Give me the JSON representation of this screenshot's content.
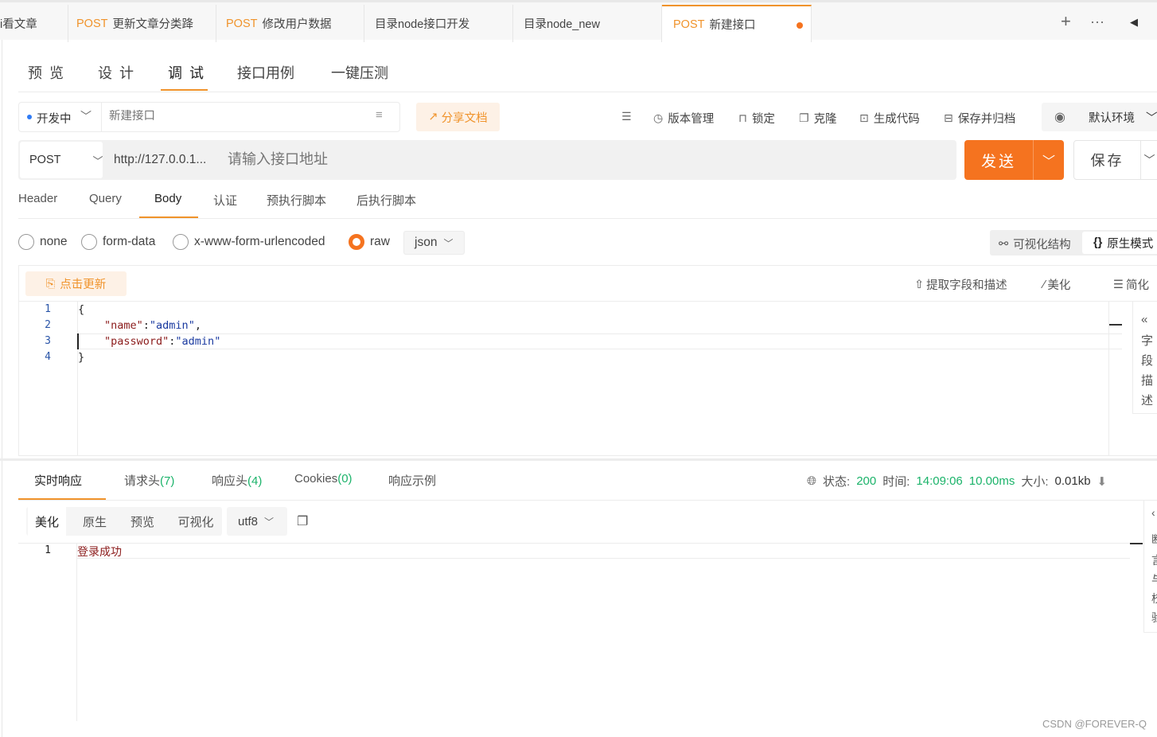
{
  "tabs": [
    {
      "method": "",
      "title": "i看文章"
    },
    {
      "method": "POST",
      "title": "更新文章分类跭"
    },
    {
      "method": "POST",
      "title": "修改用户数据"
    },
    {
      "method": "",
      "title": "目录node接口开发"
    },
    {
      "method": "",
      "title": "目录node_new"
    },
    {
      "method": "POST",
      "title": "新建接口"
    }
  ],
  "tabbar_icons": {
    "add": "+",
    "more": "···",
    "prev": "◀"
  },
  "subnav": [
    "预 览",
    "设 计",
    "调 试",
    "接口用例",
    "一键压测"
  ],
  "status": {
    "label": "开发中",
    "name_placeholder": "新建接口"
  },
  "share_button": "分享文档",
  "tools": [
    "版本管理",
    "锁定",
    "克隆",
    "生成代码",
    "保存并归档"
  ],
  "environment": "默认环境",
  "request": {
    "method": "POST",
    "url": "http://127.0.0.1...",
    "url_placeholder": "请输入接口地址",
    "send": "发送",
    "save": "保存"
  },
  "request_tabs": [
    "Header",
    "Query",
    "Body",
    "认证",
    "预执行脚本",
    "后执行脚本"
  ],
  "body_types": [
    "none",
    "form-data",
    "x-www-form-urlencoded",
    "raw"
  ],
  "body_format": "json",
  "modes": {
    "visual": "可视化结构",
    "raw": "原生模式"
  },
  "editor_toolbar": {
    "refresh": "点击更新",
    "extract": "提取字段和描述",
    "beautify": "美化",
    "simplify": "简化"
  },
  "code_lines": [
    {
      "no": "1",
      "key": "",
      "value": "{",
      "suffix": ""
    },
    {
      "no": "2",
      "key": "\"name\"",
      "value": "\"admin\"",
      "suffix": ","
    },
    {
      "no": "3",
      "key": "\"password\"",
      "value": "\"admin\"",
      "suffix": ""
    },
    {
      "no": "4",
      "key": "",
      "value": "}",
      "suffix": ""
    }
  ],
  "field_panel": [
    "«",
    "字",
    "段",
    "描",
    "述"
  ],
  "response_tabs": [
    {
      "label": "实时响应",
      "count": ""
    },
    {
      "label": "请求头",
      "count": "(7)"
    },
    {
      "label": "响应头",
      "count": "(4)"
    },
    {
      "label": "Cookies",
      "count": "(0)"
    },
    {
      "label": "响应示例",
      "count": ""
    }
  ],
  "response_meta": {
    "status_label": "状态:",
    "status": "200",
    "time_label": "时间:",
    "time": "14:09:06",
    "duration": "10.00ms",
    "size_label": "大小:",
    "size": "0.01kb"
  },
  "view_buttons": [
    "美化",
    "原生",
    "预览",
    "可视化"
  ],
  "encoding": "utf8",
  "response_lines": [
    {
      "no": "1",
      "text": "登录成功"
    }
  ],
  "resp_side": [
    "‹",
    "断",
    "言",
    "与",
    "校",
    "验"
  ],
  "watermark": "CSDN @FOREVER-Q",
  "colors": {
    "accent": "#f0932b",
    "send": "#f5731f",
    "success": "#1bb36a"
  }
}
